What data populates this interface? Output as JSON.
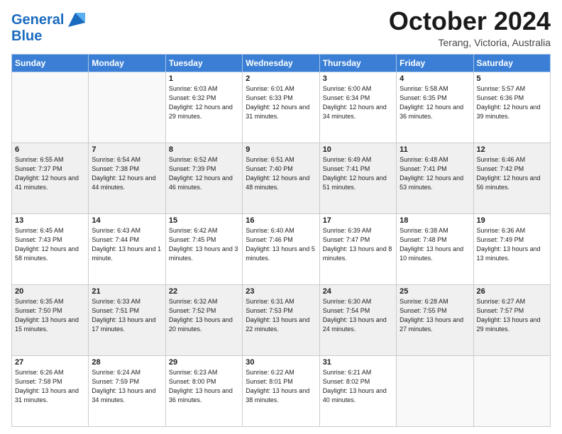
{
  "header": {
    "logo_line1": "General",
    "logo_line2": "Blue",
    "month": "October 2024",
    "location": "Terang, Victoria, Australia"
  },
  "days_of_week": [
    "Sunday",
    "Monday",
    "Tuesday",
    "Wednesday",
    "Thursday",
    "Friday",
    "Saturday"
  ],
  "weeks": [
    [
      null,
      null,
      {
        "day": 1,
        "sunrise": "6:03 AM",
        "sunset": "6:32 PM",
        "daylight": "12 hours and 29 minutes."
      },
      {
        "day": 2,
        "sunrise": "6:01 AM",
        "sunset": "6:33 PM",
        "daylight": "12 hours and 31 minutes."
      },
      {
        "day": 3,
        "sunrise": "6:00 AM",
        "sunset": "6:34 PM",
        "daylight": "12 hours and 34 minutes."
      },
      {
        "day": 4,
        "sunrise": "5:58 AM",
        "sunset": "6:35 PM",
        "daylight": "12 hours and 36 minutes."
      },
      {
        "day": 5,
        "sunrise": "5:57 AM",
        "sunset": "6:36 PM",
        "daylight": "12 hours and 39 minutes."
      }
    ],
    [
      {
        "day": 6,
        "sunrise": "6:55 AM",
        "sunset": "7:37 PM",
        "daylight": "12 hours and 41 minutes."
      },
      {
        "day": 7,
        "sunrise": "6:54 AM",
        "sunset": "7:38 PM",
        "daylight": "12 hours and 44 minutes."
      },
      {
        "day": 8,
        "sunrise": "6:52 AM",
        "sunset": "7:39 PM",
        "daylight": "12 hours and 46 minutes."
      },
      {
        "day": 9,
        "sunrise": "6:51 AM",
        "sunset": "7:40 PM",
        "daylight": "12 hours and 48 minutes."
      },
      {
        "day": 10,
        "sunrise": "6:49 AM",
        "sunset": "7:41 PM",
        "daylight": "12 hours and 51 minutes."
      },
      {
        "day": 11,
        "sunrise": "6:48 AM",
        "sunset": "7:41 PM",
        "daylight": "12 hours and 53 minutes."
      },
      {
        "day": 12,
        "sunrise": "6:46 AM",
        "sunset": "7:42 PM",
        "daylight": "12 hours and 56 minutes."
      }
    ],
    [
      {
        "day": 13,
        "sunrise": "6:45 AM",
        "sunset": "7:43 PM",
        "daylight": "12 hours and 58 minutes."
      },
      {
        "day": 14,
        "sunrise": "6:43 AM",
        "sunset": "7:44 PM",
        "daylight": "13 hours and 1 minute."
      },
      {
        "day": 15,
        "sunrise": "6:42 AM",
        "sunset": "7:45 PM",
        "daylight": "13 hours and 3 minutes."
      },
      {
        "day": 16,
        "sunrise": "6:40 AM",
        "sunset": "7:46 PM",
        "daylight": "13 hours and 5 minutes."
      },
      {
        "day": 17,
        "sunrise": "6:39 AM",
        "sunset": "7:47 PM",
        "daylight": "13 hours and 8 minutes."
      },
      {
        "day": 18,
        "sunrise": "6:38 AM",
        "sunset": "7:48 PM",
        "daylight": "13 hours and 10 minutes."
      },
      {
        "day": 19,
        "sunrise": "6:36 AM",
        "sunset": "7:49 PM",
        "daylight": "13 hours and 13 minutes."
      }
    ],
    [
      {
        "day": 20,
        "sunrise": "6:35 AM",
        "sunset": "7:50 PM",
        "daylight": "13 hours and 15 minutes."
      },
      {
        "day": 21,
        "sunrise": "6:33 AM",
        "sunset": "7:51 PM",
        "daylight": "13 hours and 17 minutes."
      },
      {
        "day": 22,
        "sunrise": "6:32 AM",
        "sunset": "7:52 PM",
        "daylight": "13 hours and 20 minutes."
      },
      {
        "day": 23,
        "sunrise": "6:31 AM",
        "sunset": "7:53 PM",
        "daylight": "13 hours and 22 minutes."
      },
      {
        "day": 24,
        "sunrise": "6:30 AM",
        "sunset": "7:54 PM",
        "daylight": "13 hours and 24 minutes."
      },
      {
        "day": 25,
        "sunrise": "6:28 AM",
        "sunset": "7:55 PM",
        "daylight": "13 hours and 27 minutes."
      },
      {
        "day": 26,
        "sunrise": "6:27 AM",
        "sunset": "7:57 PM",
        "daylight": "13 hours and 29 minutes."
      }
    ],
    [
      {
        "day": 27,
        "sunrise": "6:26 AM",
        "sunset": "7:58 PM",
        "daylight": "13 hours and 31 minutes."
      },
      {
        "day": 28,
        "sunrise": "6:24 AM",
        "sunset": "7:59 PM",
        "daylight": "13 hours and 34 minutes."
      },
      {
        "day": 29,
        "sunrise": "6:23 AM",
        "sunset": "8:00 PM",
        "daylight": "13 hours and 36 minutes."
      },
      {
        "day": 30,
        "sunrise": "6:22 AM",
        "sunset": "8:01 PM",
        "daylight": "13 hours and 38 minutes."
      },
      {
        "day": 31,
        "sunrise": "6:21 AM",
        "sunset": "8:02 PM",
        "daylight": "13 hours and 40 minutes."
      },
      null,
      null
    ]
  ]
}
